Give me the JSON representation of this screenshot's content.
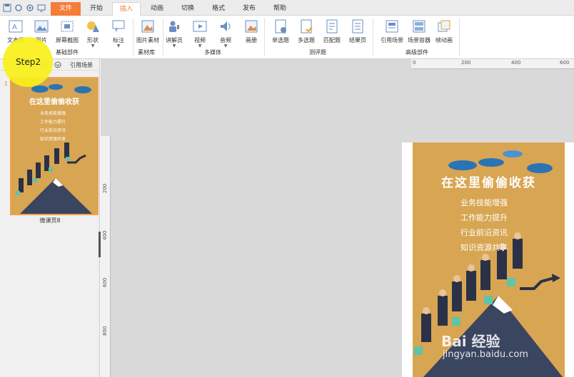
{
  "tabs": {
    "file": "文件",
    "home": "开始",
    "insert": "插入",
    "animation": "动画",
    "transition": "切换",
    "format": "格式",
    "publish": "发布",
    "help": "帮助"
  },
  "ribbon": {
    "textbox": "文本框",
    "image": "图片",
    "screenshot": "屏幕截图",
    "shape": "形状",
    "annotation": "标注",
    "image_material": "图片素材",
    "narrator": "讲解员",
    "video": "视频",
    "audio": "音频",
    "album": "画册",
    "single_choice": "单选题",
    "multi_choice": "多选题",
    "matching": "匹配题",
    "result_page": "结果页",
    "ref_scene": "引用场景",
    "scene_container": "场景容器",
    "frame_anim": "帧动画",
    "group_basic": "基础部件",
    "group_material": "素材库",
    "group_media": "多媒体",
    "group_quiz": "测评题",
    "group_advanced": "高级部件"
  },
  "left_panel": {
    "ref_scene_link": "引用场景",
    "slide_number": "1",
    "slide_caption": "微课页8"
  },
  "step_label": "Step2",
  "ruler": {
    "h_ticks": [
      "0",
      "200",
      "400",
      "600"
    ],
    "v_ticks": [
      "200",
      "400",
      "600",
      "800"
    ]
  },
  "slide": {
    "title": "在这里偷偷收获",
    "items": [
      "业务技能增强",
      "工作能力提升",
      "行业前沿资讯",
      "知识资源共享"
    ]
  },
  "watermark": {
    "logo": "Bai 经验",
    "url": "jingyan.baidu.com"
  },
  "colors": {
    "accent": "#f47d3a",
    "slide_bg": "#d8a552",
    "highlight": "#f7f01a"
  }
}
